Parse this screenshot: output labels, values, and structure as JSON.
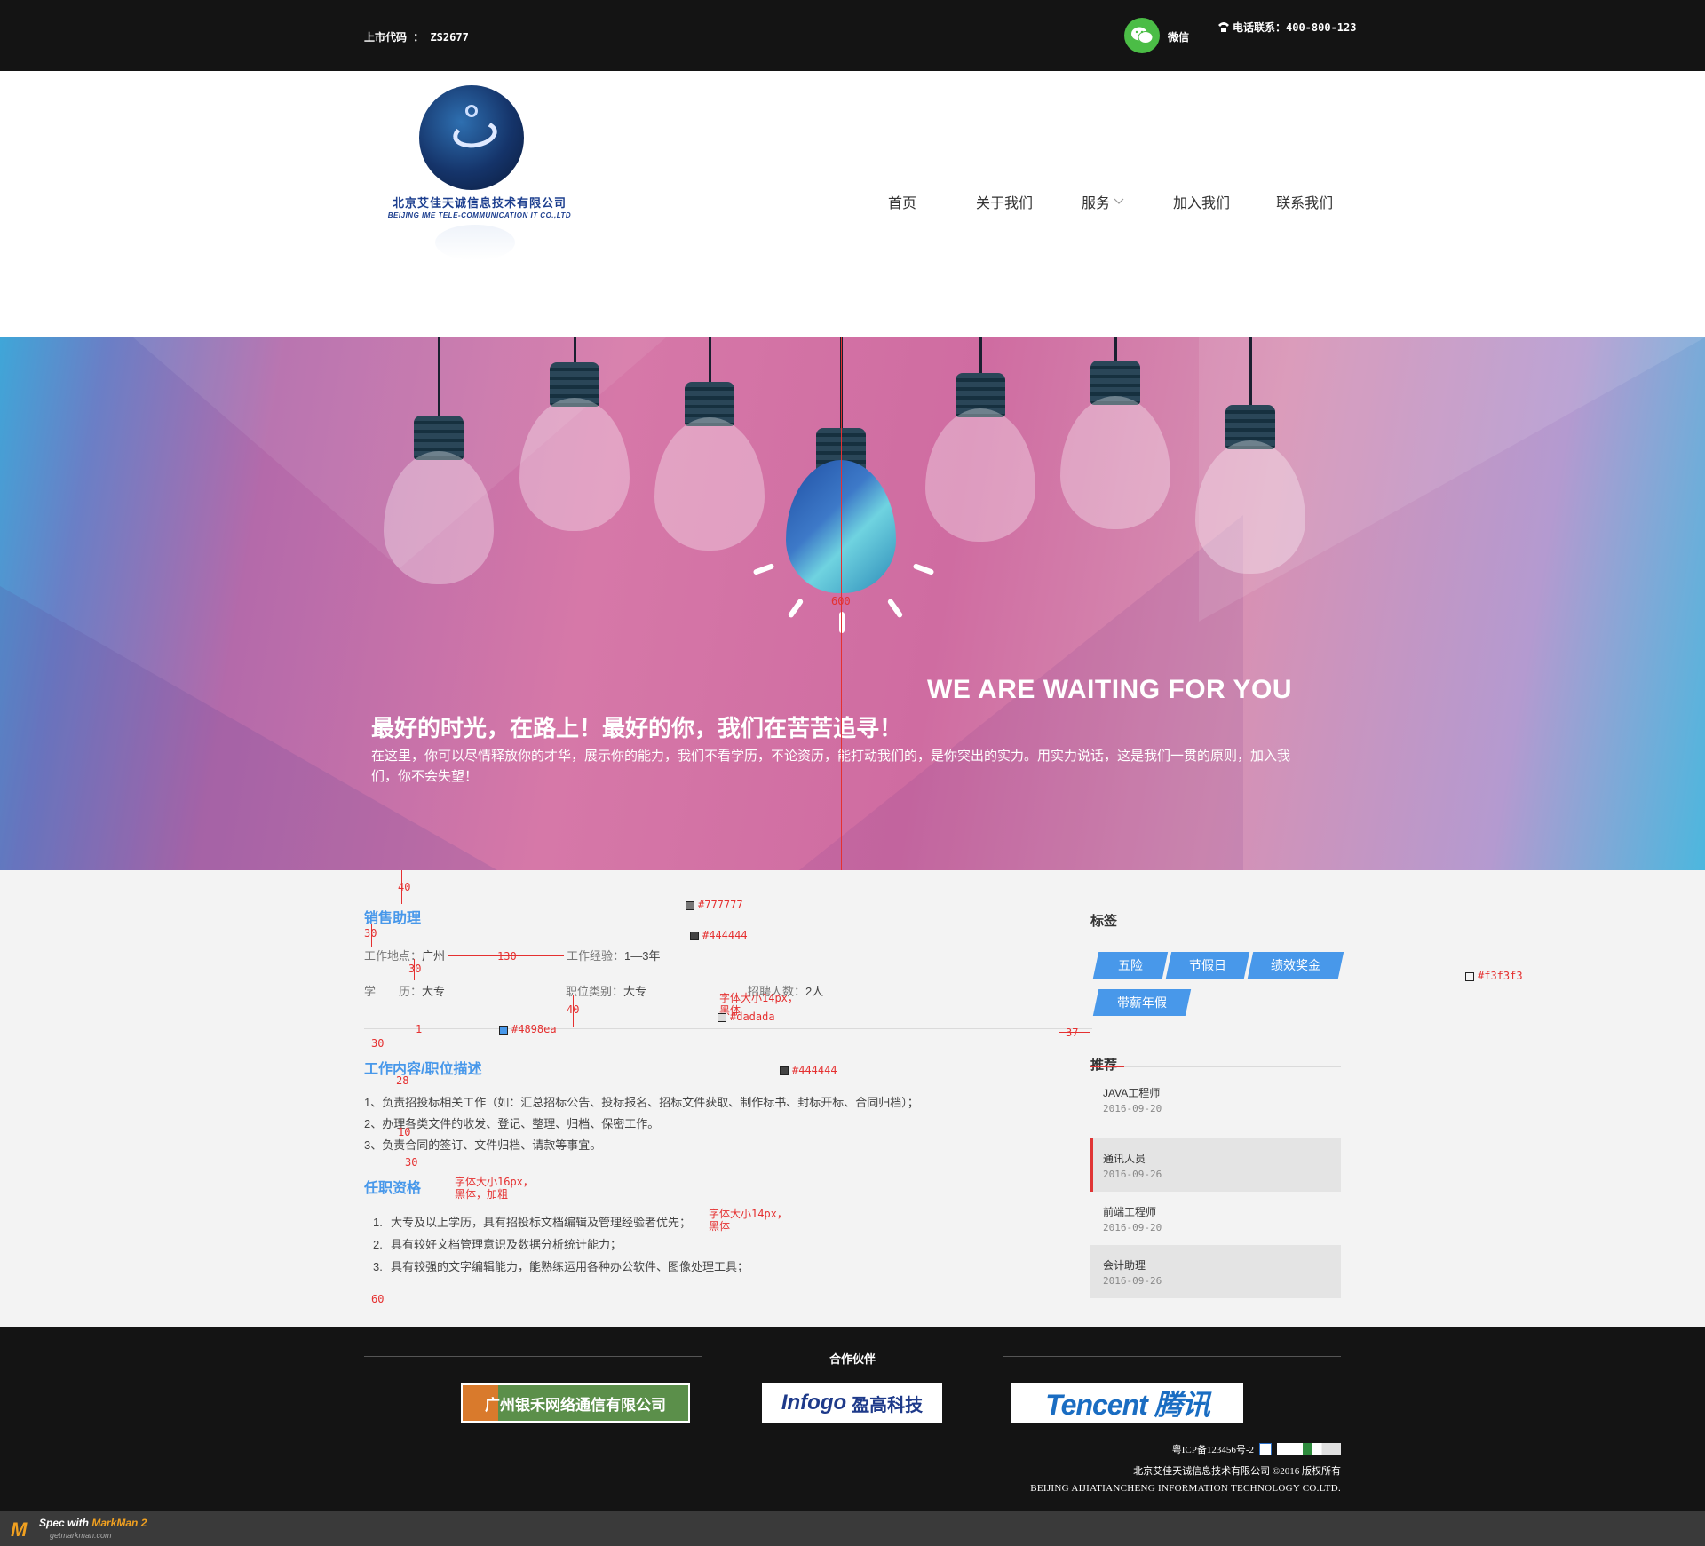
{
  "topbar": {
    "stock_code": "上市代码 ： ZS2677",
    "wechat": "微信",
    "phone": "电话联系：400-800-123"
  },
  "logo": {
    "name_cn": "北京艾佳天诚信息技术有限公司",
    "name_en": "BEIJING IME TELE-COMMUNICATION IT CO.,LTD"
  },
  "nav": {
    "items": [
      "首页",
      "关于我们",
      "服务",
      "加入我们",
      "联系我们"
    ]
  },
  "banner": {
    "tagline_en": "WE ARE WAITING FOR YOU",
    "title": "最好的时光，在路上！最好的你，我们在苦苦追寻！",
    "desc": "在这里，你可以尽情释放你的才华，展示你的能力，我们不看学历，不论资历，能打动我们的，是你突出的实力。用实力说话，这是我们一贯的原则，加入我们，你不会失望！"
  },
  "job": {
    "title": "销售助理",
    "location_label": "工作地点：",
    "location": "广州",
    "experience_label": "工作经验：",
    "experience": "1—3年",
    "education_label": "学　　历：",
    "education": "大专",
    "category_label": "职位类别：",
    "category": "大专",
    "headcount_label": "招聘人数：",
    "headcount": "2人",
    "desc_title": "工作内容/职位描述",
    "duties": [
      "1、负责招投标相关工作（如：汇总招标公告、投标报名、招标文件获取、制作标书、封标开标、合同归档）；",
      "2、办理各类文件的收发、登记、整理、归档、保密工作。",
      "3、负责合同的签订、文件归档、请款等事宜。"
    ],
    "req_title": "任职资格",
    "requirements": [
      "大专及以上学历，具有招投标文档编辑及管理经验者优先；",
      "具有较好文档管理意识及数据分析统计能力；",
      "具有较强的文字编辑能力，能熟练运用各种办公软件、图像处理工具；"
    ]
  },
  "sidebar": {
    "tags_title": "标签",
    "tags": [
      "五险",
      "节假日",
      "绩效奖金",
      "带薪年假"
    ],
    "rec_title": "推荐",
    "recommendations": [
      {
        "title": "JAVA工程师",
        "date": "2016-09-20"
      },
      {
        "title": "通讯人员",
        "date": "2016-09-26"
      },
      {
        "title": "前端工程师",
        "date": "2016-09-20"
      },
      {
        "title": "会计助理",
        "date": "2016-09-26"
      }
    ]
  },
  "annotations": {
    "a40": "40",
    "a30": "30",
    "a130": "130",
    "a30b": "30",
    "a40b": "40",
    "a1": "1",
    "a30c": "30",
    "a28": "28",
    "a10": "10",
    "a30d": "30",
    "a60": "60",
    "a37": "37",
    "a600": "600",
    "c777": "#777777",
    "c444": "#444444",
    "c444b": "#444444",
    "cdad": "#dadada",
    "c4898": "#4898ea",
    "cf3": "#f3f3f3",
    "f14a": "字体大小14px，",
    "f14a2": "黑体",
    "f16": "字体大小16px，",
    "f16b": "黑体，加粗",
    "f14b": "字体大小14px，",
    "f14b2": "黑体"
  },
  "footer": {
    "partners_title": "合作伙伴",
    "partner1": "广州银禾网络通信有限公司",
    "partner2": "Infogo",
    "partner2_cn": "盈高科技",
    "partner3": "Tencent 腾讯",
    "icp": "粤ICP备123456号-2",
    "copyright": "北京艾佳天诚信息技术有限公司 ©2016 版权所有",
    "company_en": "BEIJING AIJIATIANCHENG INFORMATION TECHNOLOGY CO.LTD."
  },
  "markman": {
    "line1_a": "Spec with ",
    "line1_b": "MarkMan 2",
    "line2": "getmarkman.com"
  },
  "colors": {
    "blue": "#4898ea",
    "text": "#444444",
    "label": "#777777",
    "divider": "#dadada",
    "bg": "#f3f3f3",
    "red": "#e03535"
  }
}
